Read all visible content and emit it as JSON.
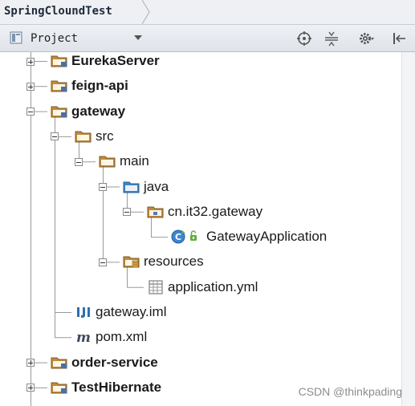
{
  "breadcrumb": {
    "label": "SpringCloundTest"
  },
  "panel": {
    "view_label": "Project"
  },
  "toolbar": {
    "icons": [
      "locate-icon",
      "collapse-all-icon",
      "gear-icon",
      "hide-panel-icon"
    ]
  },
  "tree": {
    "items": [
      {
        "label": "EurekaServer",
        "icon": "module-folder-icon",
        "expanded": false,
        "bold": true
      },
      {
        "label": "feign-api",
        "icon": "module-folder-icon",
        "expanded": false,
        "bold": true
      },
      {
        "label": "gateway",
        "icon": "module-folder-icon",
        "expanded": true,
        "bold": true
      },
      {
        "label": "src",
        "icon": "folder-icon",
        "expanded": true,
        "bold": false
      },
      {
        "label": "main",
        "icon": "folder-icon",
        "expanded": true,
        "bold": false
      },
      {
        "label": "java",
        "icon": "source-folder-icon",
        "expanded": true,
        "bold": false
      },
      {
        "label": "cn.it32.gateway",
        "icon": "package-icon",
        "expanded": true,
        "bold": false
      },
      {
        "label": "GatewayApplication",
        "icon": "spring-class-icon",
        "expanded": null,
        "bold": false
      },
      {
        "label": "resources",
        "icon": "resources-folder-icon",
        "expanded": true,
        "bold": false
      },
      {
        "label": "application.yml",
        "icon": "yml-file-icon",
        "expanded": null,
        "bold": false
      },
      {
        "label": "gateway.iml",
        "icon": "iml-file-icon",
        "expanded": null,
        "bold": false
      },
      {
        "label": "pom.xml",
        "icon": "maven-file-icon",
        "expanded": null,
        "bold": false
      },
      {
        "label": "order-service",
        "icon": "module-folder-icon",
        "expanded": false,
        "bold": true
      },
      {
        "label": "TestHibernate",
        "icon": "module-folder-icon",
        "expanded": false,
        "bold": true
      }
    ]
  },
  "watermark": {
    "text": "CSDN @thinkpading"
  },
  "colors": {
    "folder": "#c08a3e",
    "source_folder": "#3f86c6",
    "class_icon": "#3d86d0",
    "spring": "#5fae3e"
  }
}
